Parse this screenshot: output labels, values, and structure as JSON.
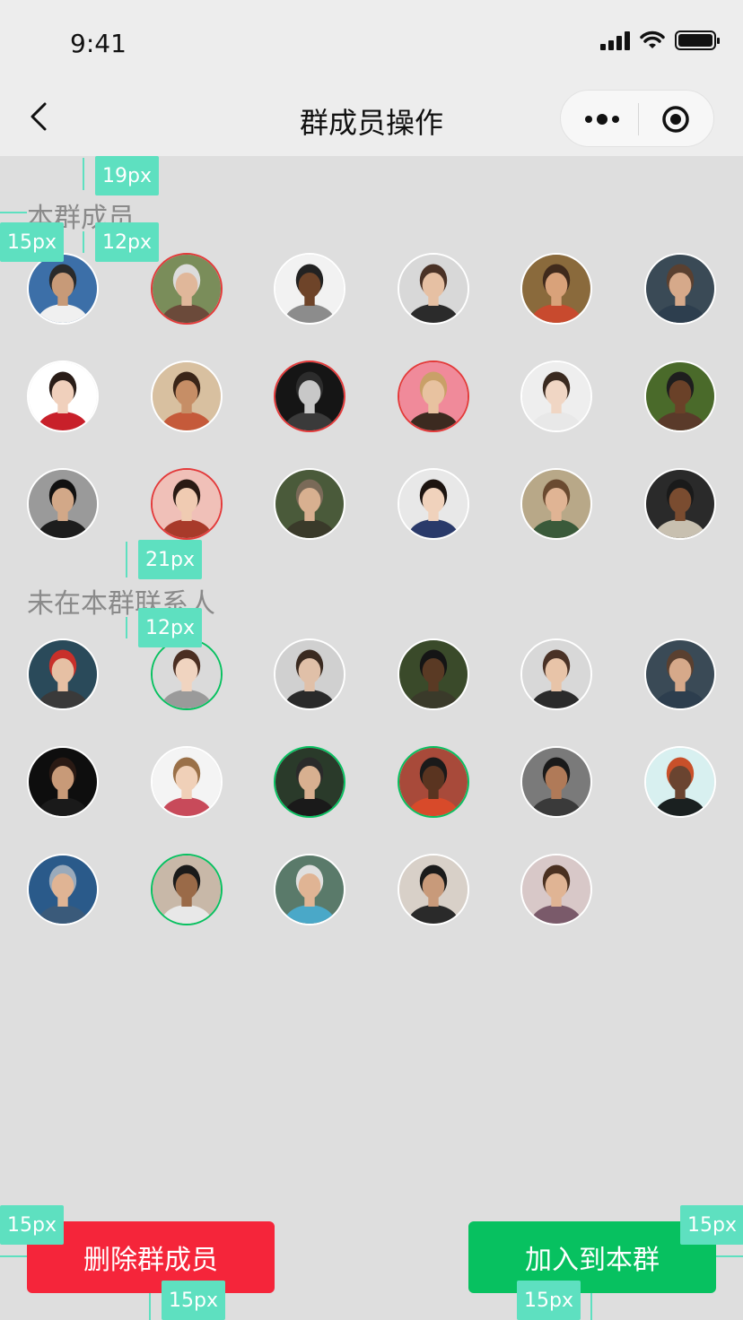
{
  "status_bar": {
    "time": "9:41"
  },
  "nav": {
    "title": "群成员操作"
  },
  "sections": {
    "members_label": "本群成员",
    "contacts_label": "未在本群联系人"
  },
  "members": [
    {
      "name": "member-1",
      "state": "normal",
      "skin": "#c79a78",
      "hair": "#2a2a2a",
      "shirt": "#f0f0f0",
      "bg": "#3c6fa8"
    },
    {
      "name": "member-2",
      "state": "selected",
      "skin": "#e0b79a",
      "hair": "#dcdcdc",
      "shirt": "#6b4a3a",
      "bg": "#7a8d5a"
    },
    {
      "name": "member-3",
      "state": "normal",
      "skin": "#6e4429",
      "hair": "#222222",
      "shirt": "#8c8c8c",
      "bg": "#f2f2f2"
    },
    {
      "name": "member-4",
      "state": "normal",
      "skin": "#e6c0a3",
      "hair": "#4a3226",
      "shirt": "#2b2b2b",
      "bg": "#d8d8d8"
    },
    {
      "name": "member-5",
      "state": "normal",
      "skin": "#d9a27a",
      "hair": "#402a1c",
      "shirt": "#c84a2e",
      "bg": "#8a6a3c"
    },
    {
      "name": "member-6",
      "state": "normal",
      "skin": "#d6a98a",
      "hair": "#5a4030",
      "shirt": "#2d3e4e",
      "bg": "#3a4a56"
    },
    {
      "name": "member-7",
      "state": "normal",
      "skin": "#f0d0bc",
      "hair": "#2a1d18",
      "shirt": "#c8202a",
      "bg": "#ffffff"
    },
    {
      "name": "member-8",
      "state": "normal",
      "skin": "#c68e66",
      "hair": "#3a2518",
      "shirt": "#c55a3a",
      "bg": "#d8c0a0"
    },
    {
      "name": "member-9",
      "state": "selected",
      "skin": "#c8c8c8",
      "hair": "#2c2c2c",
      "shirt": "#3a3a3a",
      "bg": "#151515"
    },
    {
      "name": "member-10",
      "state": "selected",
      "skin": "#e8c2a0",
      "hair": "#c9a068",
      "shirt": "#3c2a20",
      "bg": "#f08a9a"
    },
    {
      "name": "member-11",
      "state": "normal",
      "skin": "#f0d6c4",
      "hair": "#3a2a20",
      "shirt": "#e8e8e8",
      "bg": "#eeeeee"
    },
    {
      "name": "member-12",
      "state": "normal",
      "skin": "#6a4128",
      "hair": "#1e1e1e",
      "shirt": "#5a3a2a",
      "bg": "#4a6a2a"
    },
    {
      "name": "member-13",
      "state": "normal",
      "skin": "#d2a888",
      "hair": "#111111",
      "shirt": "#1d1d1d",
      "bg": "#9a9a9a"
    },
    {
      "name": "member-14",
      "state": "selected",
      "skin": "#f0cbb2",
      "hair": "#2a1a14",
      "shirt": "#a83a2a",
      "bg": "#f0c0b8"
    },
    {
      "name": "member-15",
      "state": "normal",
      "skin": "#d8b090",
      "hair": "#7a6a58",
      "shirt": "#3a3a2a",
      "bg": "#4a5a3a"
    },
    {
      "name": "member-16",
      "state": "normal",
      "skin": "#f0d2bc",
      "hair": "#1c1410",
      "shirt": "#2a3a6a",
      "bg": "#e8e8e8"
    },
    {
      "name": "member-17",
      "state": "normal",
      "skin": "#e0b494",
      "hair": "#6a4a30",
      "shirt": "#3a5a3a",
      "bg": "#b8a888"
    },
    {
      "name": "member-18",
      "state": "normal",
      "skin": "#7a4c30",
      "hair": "#1a1a1a",
      "shirt": "#c8c0b0",
      "bg": "#2a2a2a"
    }
  ],
  "contacts": [
    {
      "name": "contact-1",
      "state": "normal",
      "skin": "#e6c0a4",
      "hair": "#c8302a",
      "shirt": "#3a3a3a",
      "bg": "#2a4a5a"
    },
    {
      "name": "contact-2",
      "state": "selected",
      "skin": "#f0d4c0",
      "hair": "#4a2e22",
      "shirt": "#9a9a9a",
      "bg": "#dadada"
    },
    {
      "name": "contact-3",
      "state": "normal",
      "skin": "#e0c0a8",
      "hair": "#3a2a20",
      "shirt": "#2a2a2a",
      "bg": "#d0d0d0"
    },
    {
      "name": "contact-4",
      "state": "normal",
      "skin": "#5a3a24",
      "hair": "#151515",
      "shirt": "#3a3a2a",
      "bg": "#3a4a2a"
    },
    {
      "name": "contact-5",
      "state": "normal",
      "skin": "#e8c4a8",
      "hair": "#4a3226",
      "shirt": "#2b2b2b",
      "bg": "#d8d8d8"
    },
    {
      "name": "contact-6",
      "state": "normal",
      "skin": "#d6a98a",
      "hair": "#5a4030",
      "shirt": "#2d3e4e",
      "bg": "#3a4a56"
    },
    {
      "name": "contact-7",
      "state": "normal",
      "skin": "#c89a78",
      "hair": "#2a1a14",
      "shirt": "#1a1a1a",
      "bg": "#0e0e0e"
    },
    {
      "name": "contact-8",
      "state": "normal",
      "skin": "#f0d0b8",
      "hair": "#9a7048",
      "shirt": "#c84a5a",
      "bg": "#f4f4f4"
    },
    {
      "name": "contact-9",
      "state": "selected",
      "skin": "#d8b090",
      "hair": "#2a2a2a",
      "shirt": "#1a1a1a",
      "bg": "#2a3a2a"
    },
    {
      "name": "contact-10",
      "state": "selected",
      "skin": "#5a3420",
      "hair": "#1a1a1a",
      "shirt": "#d84a2a",
      "bg": "#a84a3a"
    },
    {
      "name": "contact-11",
      "state": "normal",
      "skin": "#b07a58",
      "hair": "#1a1a1a",
      "shirt": "#3a3a3a",
      "bg": "#7a7a7a"
    },
    {
      "name": "contact-12",
      "state": "normal",
      "skin": "#6a4430",
      "hair": "#c8502a",
      "shirt": "#1a2020",
      "bg": "#d8f0f0"
    },
    {
      "name": "contact-13",
      "state": "normal",
      "skin": "#e0b494",
      "hair": "#9aaabb",
      "shirt": "#3a5a7a",
      "bg": "#2a5a8a"
    },
    {
      "name": "contact-14",
      "state": "selected",
      "skin": "#9a6a48",
      "hair": "#1a1a1a",
      "shirt": "#e8e8e8",
      "bg": "#c8b8a8"
    },
    {
      "name": "contact-15",
      "state": "normal",
      "skin": "#e0b494",
      "hair": "#e0e0e0",
      "shirt": "#4aa8c8",
      "bg": "#5a7a6a"
    },
    {
      "name": "contact-16",
      "state": "normal",
      "skin": "#c89a7a",
      "hair": "#1a1a1a",
      "shirt": "#2a2a2a",
      "bg": "#d8d0c8"
    },
    {
      "name": "contact-17",
      "state": "normal",
      "skin": "#e0b494",
      "hair": "#4a3020",
      "shirt": "#7a5a6a",
      "bg": "#d8c8c8"
    }
  ],
  "buttons": {
    "delete_label": "删除群成员",
    "add_label": "加入到本群"
  },
  "annotations": {
    "a1": "19px",
    "a2": "15px",
    "a3": "12px",
    "a4": "21px",
    "a5": "12px",
    "a6": "15px",
    "a7": "15px",
    "a8": "15px",
    "a9": "15px"
  },
  "colors": {
    "danger": "#f5253a",
    "primary": "#07c160",
    "selected_member_border": "#e43a3a",
    "selected_contact_border": "#07c160",
    "annotation": "#5ee0c0"
  }
}
